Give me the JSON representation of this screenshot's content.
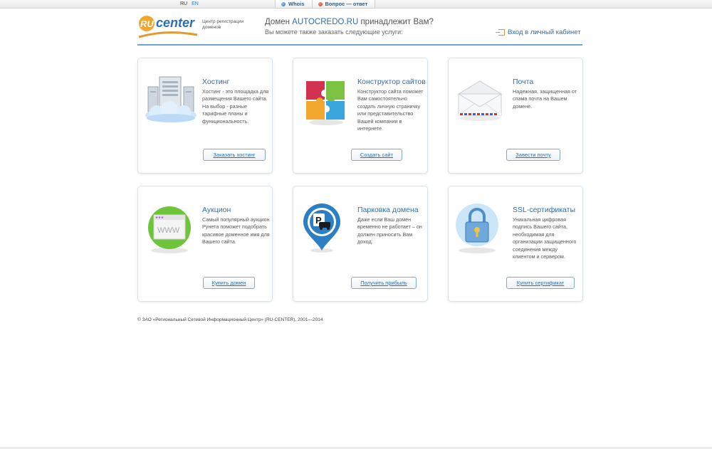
{
  "topbar": {
    "tabs": [
      {
        "label": "Whois",
        "icon": "whois-globe-icon"
      },
      {
        "label": "Вопрос — ответ",
        "icon": "question-answer-icon"
      }
    ]
  },
  "lang": {
    "ru": "RU",
    "en": "EN"
  },
  "header": {
    "logo_text": "center",
    "logo_mark": "RU",
    "logo_sub": "Центр регистрации доменов",
    "domain_prefix": "Домен ",
    "domain_name": "AUTOCREDO.RU",
    "domain_suffix": " принадлежит Вам?",
    "subtitle": "Вы можете также заказать следующие услуги:",
    "login_label": "Вход в личный кабинет"
  },
  "cards": [
    {
      "title": "Хостинг",
      "text": "Хостинг - это площадка для размещения Вашего сайта. На выбор - разные тарифные планы и функциональность.",
      "button": "Заказать хостинг",
      "icon": "server-cloud-icon"
    },
    {
      "title": "Конструктор сайтов",
      "text": "Конструктор сайта поможет Вам самостоятельно создать личную страничку или представительство Вашей компании в интернете.",
      "button": "Создать сайт",
      "icon": "puzzle-icon"
    },
    {
      "title": "Почта",
      "text": "Надежная, защищенная от спама почта на Вашем домене.",
      "button": "Завести почту",
      "icon": "envelope-icon"
    },
    {
      "title": "Аукцион",
      "text": "Самый популярный аукцион Рунета поможет подобрать красивое доменное имя для Вашего сайта.",
      "button": "Купить домен",
      "icon": "www-browser-icon"
    },
    {
      "title": "Парковка домена",
      "text": "Даже если Ваш домен временно не работает – он должен приносить Вам доход.",
      "button": "Получить прибыль",
      "icon": "parking-pin-icon"
    },
    {
      "title": "SSL-сертификаты",
      "text": "Уникальная цифровая подпись Вашего сайта, необходимая для организации защищенного соединения между клиентом и сервером.",
      "button": "Купить сертификат",
      "icon": "padlock-icon"
    }
  ],
  "footer": {
    "copyright": "© ЗАО «Региональный Сетевой Информационный Центр» (RU-CENTER), 2001—2014"
  },
  "colors": {
    "accent": "#2b6fae",
    "rule": "#6aa3d4",
    "orange": "#e39a2c"
  }
}
